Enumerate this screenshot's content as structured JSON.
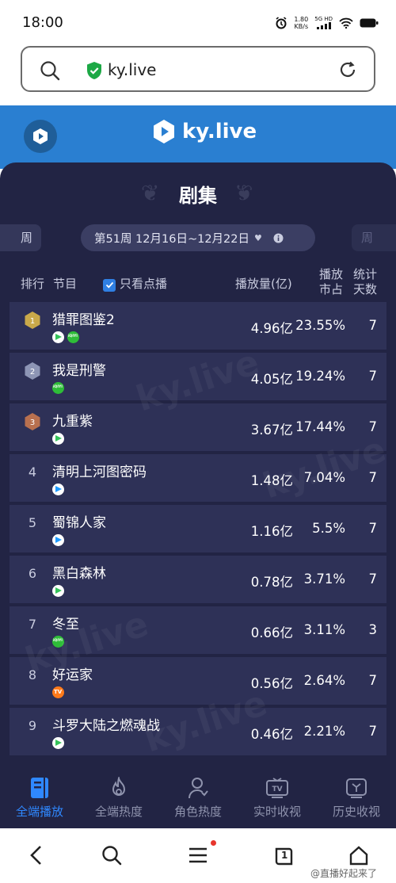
{
  "status_bar": {
    "time": "18:00",
    "speed_value": "1.80",
    "speed_unit": "KB/s",
    "network": "5G HD"
  },
  "browser": {
    "url": "ky.live"
  },
  "header": {
    "brand": "ky.live"
  },
  "panel": {
    "title": "剧集",
    "prev_week_label": "周",
    "next_week_label": "周",
    "week_range": "第51周 12月16日~12月22日",
    "columns": {
      "rank": "排行",
      "program": "节目",
      "only_vod": "只看点播",
      "plays": "播放量(亿)",
      "share_line1": "播放",
      "share_line2": "市占",
      "days_line1": "统计",
      "days_line2": "天数"
    },
    "rows": [
      {
        "rank": "1",
        "name": "猎罪图鉴2",
        "plays": "4.96亿",
        "share": "23.55%",
        "days": "7"
      },
      {
        "rank": "2",
        "name": "我是刑警",
        "plays": "4.05亿",
        "share": "19.24%",
        "days": "7"
      },
      {
        "rank": "3",
        "name": "九重紫",
        "plays": "3.67亿",
        "share": "17.44%",
        "days": "7"
      },
      {
        "rank": "4",
        "name": "清明上河图密码",
        "plays": "1.48亿",
        "share": "7.04%",
        "days": "7"
      },
      {
        "rank": "5",
        "name": "蜀锦人家",
        "plays": "1.16亿",
        "share": "5.5%",
        "days": "7"
      },
      {
        "rank": "6",
        "name": "黑白森林",
        "plays": "0.78亿",
        "share": "3.71%",
        "days": "7"
      },
      {
        "rank": "7",
        "name": "冬至",
        "plays": "0.66亿",
        "share": "3.11%",
        "days": "3"
      },
      {
        "rank": "8",
        "name": "好运家",
        "plays": "0.56亿",
        "share": "2.64%",
        "days": "7"
      },
      {
        "rank": "9",
        "name": "斗罗大陆之燃魂战",
        "plays": "0.46亿",
        "share": "2.21%",
        "days": "7"
      }
    ],
    "watermark_text": "ky.live"
  },
  "tabs": [
    {
      "label": "全端播放"
    },
    {
      "label": "全端热度"
    },
    {
      "label": "角色热度"
    },
    {
      "label": "实时收视"
    },
    {
      "label": "历史收视"
    }
  ],
  "sysnav": {
    "tabs_count": "1",
    "weibo_text": "@直播好起来了"
  },
  "colors": {
    "header_blue": "#2a7fd1",
    "panel_bg": "#222444",
    "row_alt": "#2e3157",
    "accent": "#2f88ff",
    "gold": "#c9a94a",
    "silver": "#8d95b5",
    "bronze": "#b8704f"
  }
}
